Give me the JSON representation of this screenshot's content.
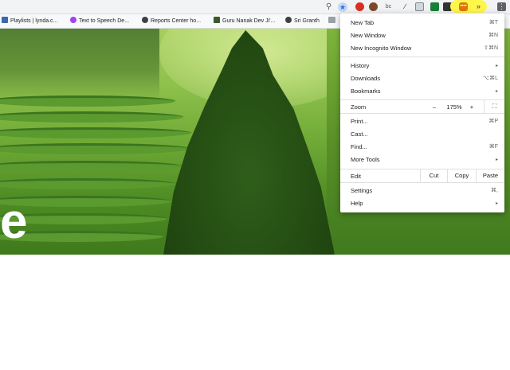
{
  "toolbar": {
    "search_icon": "magnifier-icon",
    "star_icon": "★",
    "ext3_text": "bc",
    "ext4_text": "∕",
    "ext8_text": "••••",
    "ext9_text": "»",
    "menu_icon": "⋮"
  },
  "bookmarks": [
    {
      "label": "Playlists | lynda.c..."
    },
    {
      "label": "Text to Speech De..."
    },
    {
      "label": "Reports Center ho..."
    },
    {
      "label": "Guru Nanak Dev Ji'..."
    },
    {
      "label": "Sri Granth"
    },
    {
      "label": ""
    }
  ],
  "hero": {
    "letter": "e"
  },
  "menu": {
    "new_tab": {
      "label": "New Tab",
      "shortcut": "⌘T"
    },
    "new_window": {
      "label": "New Window",
      "shortcut": "⌘N"
    },
    "new_incognito": {
      "label": "New Incognito Window",
      "shortcut": "⇧⌘N"
    },
    "history": {
      "label": "History",
      "arrow": "▸"
    },
    "downloads": {
      "label": "Downloads",
      "shortcut": "⌥⌘L"
    },
    "bookmarks": {
      "label": "Bookmarks",
      "arrow": "▸"
    },
    "zoom": {
      "label": "Zoom",
      "minus": "–",
      "value": "175%",
      "plus": "+",
      "fullscreen": "⛶"
    },
    "print": {
      "label": "Print...",
      "shortcut": "⌘P"
    },
    "cast": {
      "label": "Cast..."
    },
    "find": {
      "label": "Find...",
      "shortcut": "⌘F"
    },
    "more_tools": {
      "label": "More Tools",
      "arrow": "▸"
    },
    "edit": {
      "label": "Edit",
      "cut": "Cut",
      "copy": "Copy",
      "paste": "Paste"
    },
    "settings": {
      "label": "Settings",
      "shortcut": "⌘,"
    },
    "help": {
      "label": "Help",
      "arrow": "▸"
    }
  }
}
